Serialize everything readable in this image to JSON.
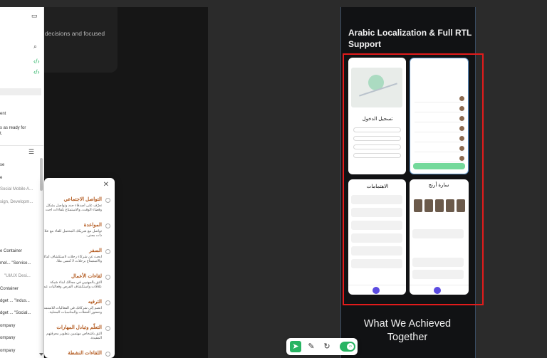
{
  "canvas": {
    "top_card_text": "decisions and focused",
    "heading": "Arabic Localization & Full RTL Support",
    "achieved": "What We Achieved Together",
    "mock_login_title": "تسجيل الدخول",
    "mock_interests": "الاهتمامات",
    "mock_profile": "سارة أرنج"
  },
  "sidebar": {
    "panel_icon": "panel-toggle-icon",
    "search_icon": "search-icon",
    "code_icon": "code-icon",
    "texts": [
      "ent",
      "s as ready for",
      "t.",
      "se",
      "e",
      "Social Mobile A...",
      "sign, Developm...",
      "e Container",
      "mel... \"Service...",
      "\"UI/UX Desi...",
      "Container",
      "dget ... \"Indus...",
      "dget ... \"Social...",
      "ompany",
      "ompany",
      "ompany"
    ]
  },
  "popup": {
    "items": [
      {
        "title": "التواصل الاجتماعي",
        "desc": "تعرّف على أصدقاء جدد وتواصل بشكل وقضاء الوقت، والاستمتاع بلقاءات اجت"
      },
      {
        "title": "المواعدة",
        "desc": "تواصل مع شريكك المحتمل للقاء مع علاقة ذات معنى."
      },
      {
        "title": "السفر",
        "desc": "ابحث عن شركاء رحلات لاستكشاف أماكن والاستمتاع برحلات لا تُنسى معًا."
      },
      {
        "title": "لقاءات الأعمال",
        "desc": "التق بالمهنيين في مجالك لبناء شبكة علاقات واستكشاف الفرص وفعاليات عمل."
      },
      {
        "title": "الترفيه",
        "desc": "انضم إلى شركائك في الفعاليات للاستمتاع وحضور الحفلات والمناسبات المحلية."
      },
      {
        "title": "التعلّم وتبادل المهارات",
        "desc": "التق بأشخاص مهتمين بتطوير معرفتهم المفيدة."
      },
      {
        "title": "اللقاءات النشطة",
        "desc": ""
      }
    ]
  },
  "toolbar": {
    "tools": [
      "select-tool",
      "pen-tool",
      "rotate-tool",
      "code-toggle"
    ]
  },
  "colors": {
    "accent_green": "#28b463",
    "highlight_red": "#e21b1b",
    "panel_border": "#3a4d63"
  }
}
